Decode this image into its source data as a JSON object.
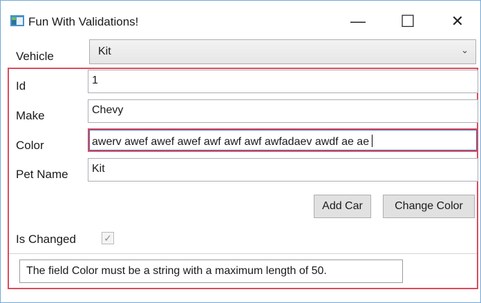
{
  "window": {
    "title": "Fun With Validations!",
    "minimize_glyph": "—",
    "maximize_glyph": "☐",
    "close_glyph": "✕"
  },
  "form": {
    "vehicle_label": "Vehicle",
    "vehicle_selected": "Kit",
    "combo_arrow": "⌄",
    "id_label": "Id",
    "id_value": "1",
    "make_label": "Make",
    "make_value": "Chevy",
    "color_label": "Color",
    "color_value": "awerv awef awef awef awf awf awf awfadaev awdf ae ae",
    "pet_name_label": "Pet Name",
    "pet_name_value": "Kit",
    "add_car_label": "Add Car",
    "change_color_label": "Change Color",
    "is_changed_label": "Is Changed",
    "is_changed_checked": true,
    "check_glyph": "✓"
  },
  "validation": {
    "summary_message": "The field Color must be a string with a maximum length of 50."
  },
  "colors": {
    "error_border": "#dc4a5a",
    "focus_border": "#3a6bc4",
    "window_border": "#6fa7d6"
  }
}
